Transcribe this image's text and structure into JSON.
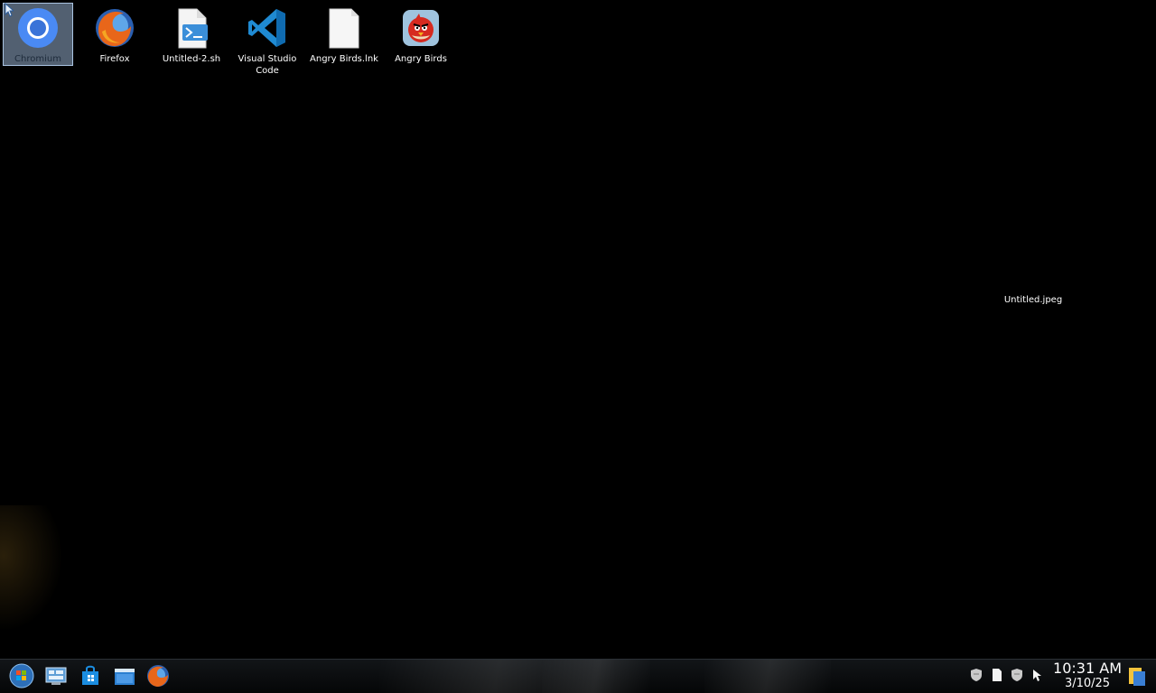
{
  "desktop": {
    "icons": [
      {
        "label": "Chromium",
        "icon": "chromium-icon",
        "selected": true
      },
      {
        "label": "Firefox",
        "icon": "firefox-icon"
      },
      {
        "label": "Untitled-2.sh",
        "icon": "script-file-icon"
      },
      {
        "label": "Visual Studio Code",
        "icon": "vscode-icon"
      },
      {
        "label": "Angry Birds.lnk",
        "icon": "blank-file-icon"
      },
      {
        "label": "Angry Birds",
        "icon": "angry-birds-icon"
      }
    ],
    "loose_item_label": "Untitled.jpeg"
  },
  "taskbar": {
    "buttons": [
      "start-orb-icon",
      "control-panel-icon",
      "store-icon",
      "file-explorer-icon",
      "firefox-icon"
    ],
    "tray_icons": [
      "shield-icon",
      "document-icon",
      "shield-icon",
      "cursor-icon"
    ],
    "clock": {
      "time": "10:31 AM",
      "date": "3/10/25"
    }
  },
  "colors": {
    "desktop_bg": "#000000",
    "taskbar_bg": "#0b0d0f",
    "selection": "#96afcd",
    "vscode_blue": "#1f8ad2",
    "chromium_blue": "#4a8af4",
    "angry_red": "#d62a20"
  }
}
